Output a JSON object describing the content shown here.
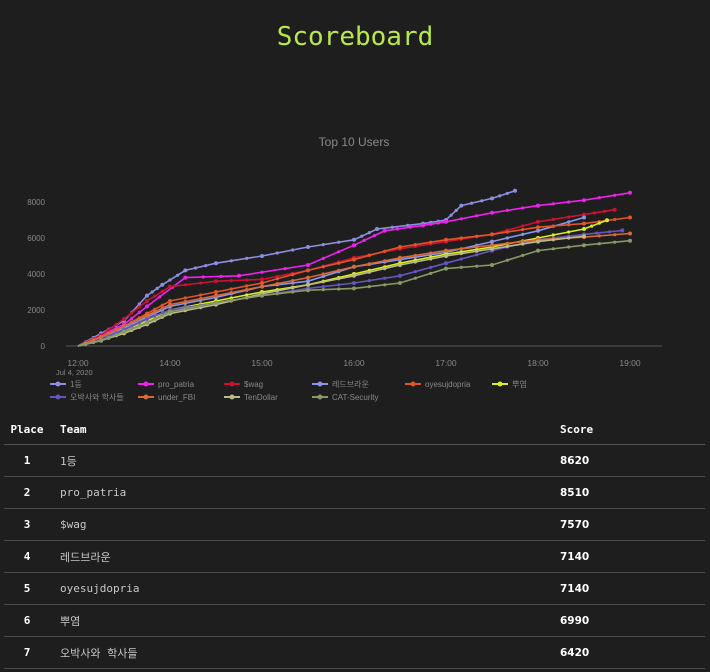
{
  "page": {
    "title": "Scoreboard"
  },
  "chart_data": {
    "type": "line",
    "title": "Top 10 Users",
    "xlabel": "",
    "ylabel": "",
    "x_ticks": [
      "12:00",
      "14:00",
      "15:00",
      "16:00",
      "17:00",
      "18:00",
      "19:00"
    ],
    "x_date_label": "Jul 4, 2020",
    "y_ticks": [
      0,
      2000,
      4000,
      6000,
      8000
    ],
    "ylim": [
      0,
      9000
    ],
    "xlim": [
      "12:00",
      "19:10"
    ],
    "grid": false,
    "legend_placement": "bottom",
    "series": [
      {
        "name": "1등",
        "color": "#8c8fe0",
        "points": [
          [
            "12:00",
            0
          ],
          [
            "12:30",
            700
          ],
          [
            "13:00",
            1400
          ],
          [
            "13:30",
            2800
          ],
          [
            "13:50",
            3400
          ],
          [
            "14:10",
            4200
          ],
          [
            "14:30",
            4600
          ],
          [
            "15:00",
            5000
          ],
          [
            "15:30",
            5500
          ],
          [
            "16:00",
            5900
          ],
          [
            "16:15",
            6500
          ],
          [
            "16:45",
            6800
          ],
          [
            "17:00",
            7000
          ],
          [
            "17:10",
            7800
          ],
          [
            "17:30",
            8200
          ],
          [
            "17:45",
            8620
          ]
        ]
      },
      {
        "name": "pro_patria",
        "color": "#ee22ee",
        "points": [
          [
            "12:00",
            0
          ],
          [
            "12:30",
            600
          ],
          [
            "13:00",
            1200
          ],
          [
            "13:30",
            2200
          ],
          [
            "14:10",
            3800
          ],
          [
            "14:45",
            3900
          ],
          [
            "15:30",
            4500
          ],
          [
            "16:00",
            5600
          ],
          [
            "16:20",
            6400
          ],
          [
            "16:45",
            6700
          ],
          [
            "17:00",
            6900
          ],
          [
            "17:30",
            7400
          ],
          [
            "18:00",
            7800
          ],
          [
            "18:30",
            8100
          ],
          [
            "19:00",
            8510
          ]
        ]
      },
      {
        "name": "$wag",
        "color": "#cc1133",
        "points": [
          [
            "12:00",
            0
          ],
          [
            "12:30",
            600
          ],
          [
            "13:00",
            1500
          ],
          [
            "13:30",
            2500
          ],
          [
            "14:00",
            3300
          ],
          [
            "14:30",
            3600
          ],
          [
            "15:00",
            3700
          ],
          [
            "15:30",
            4200
          ],
          [
            "16:00",
            4900
          ],
          [
            "16:30",
            5400
          ],
          [
            "17:00",
            5800
          ],
          [
            "17:30",
            6200
          ],
          [
            "18:00",
            6900
          ],
          [
            "18:30",
            7300
          ],
          [
            "18:50",
            7570
          ]
        ]
      },
      {
        "name": "레드브라운",
        "color": "#8896e8",
        "points": [
          [
            "12:00",
            0
          ],
          [
            "12:30",
            400
          ],
          [
            "13:00",
            1000
          ],
          [
            "13:30",
            1600
          ],
          [
            "14:00",
            2200
          ],
          [
            "14:30",
            2700
          ],
          [
            "15:00",
            3300
          ],
          [
            "15:30",
            3600
          ],
          [
            "16:00",
            4400
          ],
          [
            "16:30",
            4800
          ],
          [
            "17:00",
            5200
          ],
          [
            "17:30",
            5800
          ],
          [
            "18:00",
            6400
          ],
          [
            "18:30",
            7140
          ]
        ]
      },
      {
        "name": "oyesujdopria",
        "color": "#e0552a",
        "points": [
          [
            "12:00",
            0
          ],
          [
            "12:30",
            500
          ],
          [
            "13:00",
            1100
          ],
          [
            "13:30",
            1800
          ],
          [
            "14:00",
            2500
          ],
          [
            "14:30",
            3000
          ],
          [
            "15:00",
            3500
          ],
          [
            "15:30",
            4200
          ],
          [
            "16:00",
            4800
          ],
          [
            "16:30",
            5500
          ],
          [
            "17:00",
            5900
          ],
          [
            "17:30",
            6200
          ],
          [
            "18:00",
            6600
          ],
          [
            "18:30",
            6800
          ],
          [
            "19:00",
            7140
          ]
        ]
      },
      {
        "name": "뿌염",
        "color": "#d8ee22",
        "points": [
          [
            "12:00",
            0
          ],
          [
            "12:30",
            300
          ],
          [
            "13:00",
            800
          ],
          [
            "13:30",
            1400
          ],
          [
            "14:00",
            2000
          ],
          [
            "14:30",
            2500
          ],
          [
            "15:00",
            3000
          ],
          [
            "15:30",
            3400
          ],
          [
            "16:00",
            4000
          ],
          [
            "16:30",
            4600
          ],
          [
            "17:00",
            5100
          ],
          [
            "17:30",
            5500
          ],
          [
            "18:00",
            6000
          ],
          [
            "18:30",
            6500
          ],
          [
            "18:45",
            6990
          ]
        ]
      },
      {
        "name": "오박사와 학사들",
        "color": "#6655bb",
        "points": [
          [
            "12:00",
            0
          ],
          [
            "12:30",
            400
          ],
          [
            "13:00",
            900
          ],
          [
            "13:30",
            1500
          ],
          [
            "14:00",
            2000
          ],
          [
            "14:30",
            2400
          ],
          [
            "15:00",
            2800
          ],
          [
            "15:30",
            3200
          ],
          [
            "16:00",
            3500
          ],
          [
            "16:30",
            3900
          ],
          [
            "17:00",
            4600
          ],
          [
            "17:30",
            5300
          ],
          [
            "18:00",
            5900
          ],
          [
            "18:30",
            6200
          ],
          [
            "18:55",
            6420
          ]
        ]
      },
      {
        "name": "under_FBI",
        "color": "#d86a3a",
        "points": [
          [
            "12:00",
            0
          ],
          [
            "12:30",
            500
          ],
          [
            "13:00",
            1100
          ],
          [
            "13:30",
            1700
          ],
          [
            "14:00",
            2300
          ],
          [
            "14:30",
            2800
          ],
          [
            "15:00",
            3300
          ],
          [
            "15:30",
            3800
          ],
          [
            "16:00",
            4400
          ],
          [
            "16:30",
            4900
          ],
          [
            "17:00",
            5300
          ],
          [
            "17:30",
            5600
          ],
          [
            "18:00",
            5900
          ],
          [
            "18:30",
            6050
          ],
          [
            "19:00",
            6250
          ]
        ]
      },
      {
        "name": "TenDollar",
        "color": "#bbbb88",
        "points": [
          [
            "12:00",
            0
          ],
          [
            "12:30",
            300
          ],
          [
            "13:00",
            700
          ],
          [
            "13:30",
            1200
          ],
          [
            "14:00",
            1800
          ],
          [
            "14:30",
            2300
          ],
          [
            "15:00",
            2900
          ],
          [
            "15:30",
            3400
          ],
          [
            "16:00",
            3900
          ],
          [
            "16:30",
            4500
          ],
          [
            "17:00",
            5000
          ],
          [
            "17:30",
            5400
          ],
          [
            "18:00",
            5800
          ],
          [
            "18:30",
            6100
          ]
        ]
      },
      {
        "name": "CAT-Security",
        "color": "#889966",
        "points": [
          [
            "12:00",
            0
          ],
          [
            "12:30",
            300
          ],
          [
            "13:00",
            800
          ],
          [
            "13:30",
            1300
          ],
          [
            "14:00",
            1900
          ],
          [
            "14:30",
            2400
          ],
          [
            "15:00",
            2800
          ],
          [
            "15:30",
            3100
          ],
          [
            "16:00",
            3200
          ],
          [
            "16:30",
            3500
          ],
          [
            "17:00",
            4300
          ],
          [
            "17:30",
            4500
          ],
          [
            "18:00",
            5300
          ],
          [
            "18:30",
            5600
          ],
          [
            "19:00",
            5850
          ]
        ]
      }
    ]
  },
  "table": {
    "headers": {
      "place": "Place",
      "team": "Team",
      "score": "Score"
    },
    "rows": [
      {
        "place": "1",
        "team": "1등",
        "score": "8620"
      },
      {
        "place": "2",
        "team": "pro_patria",
        "score": "8510"
      },
      {
        "place": "3",
        "team": "$wag",
        "score": "7570"
      },
      {
        "place": "4",
        "team": "레드브라운",
        "score": "7140"
      },
      {
        "place": "5",
        "team": "oyesujdopria",
        "score": "7140"
      },
      {
        "place": "6",
        "team": "뿌염",
        "score": "6990"
      },
      {
        "place": "7",
        "team": "오박사와 학사들",
        "score": "6420"
      }
    ]
  }
}
